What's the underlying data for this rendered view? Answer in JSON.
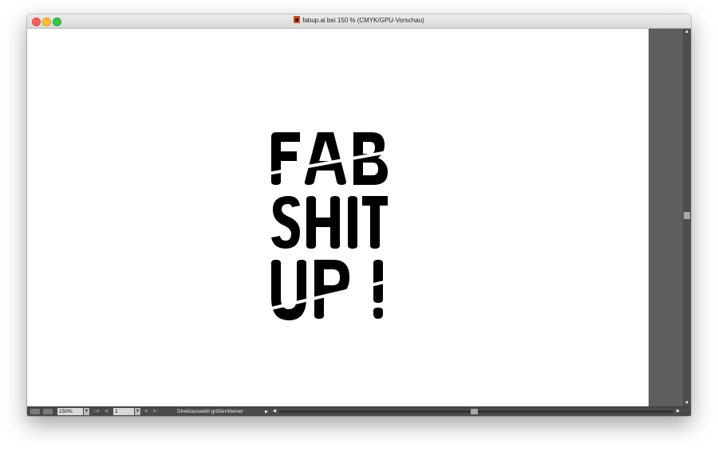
{
  "window": {
    "title": "fabup.ai bei 150 % (CMYK/GPU-Vorschau)"
  },
  "artwork": {
    "lines": [
      "FAB",
      "SHIT",
      "UP!"
    ],
    "color": "#000000"
  },
  "statusbar": {
    "zoom_value": "150%",
    "page_value": "1",
    "status_text": "Direktauswahl größer/kleiner"
  },
  "icons": {
    "close": "close-button-icon",
    "minimize": "minimize-button-icon",
    "maximize": "maximize-button-icon",
    "document": "illustrator-file-icon"
  },
  "colors": {
    "pasteboard": "#5e5e5e",
    "statusbar": "#4a4a4a",
    "titlebar": "#e4e4e4"
  }
}
